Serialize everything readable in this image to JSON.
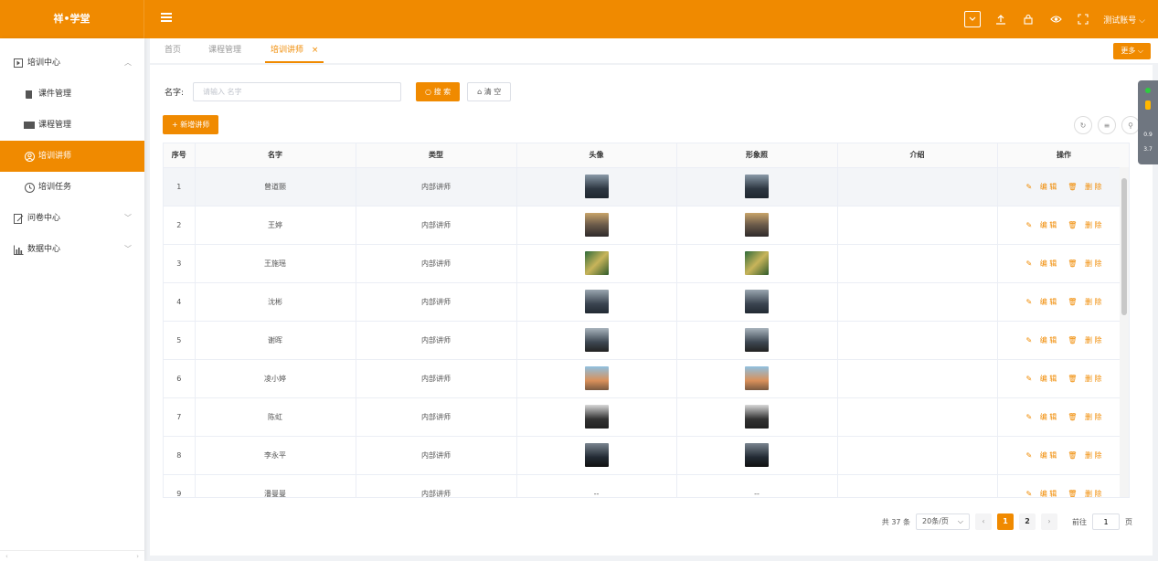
{
  "brand": "祥•学堂",
  "topbar": {
    "account": "测试账号"
  },
  "sidebar": {
    "items": [
      {
        "label": "培训中心"
      },
      {
        "label": "课件管理"
      },
      {
        "label": "课程管理"
      },
      {
        "label": "培训讲师"
      },
      {
        "label": "培训任务"
      },
      {
        "label": "问卷中心"
      },
      {
        "label": "数据中心"
      }
    ]
  },
  "tabs": [
    {
      "label": "首页"
    },
    {
      "label": "课程管理"
    },
    {
      "label": "培训讲师"
    }
  ],
  "more_label": "更多",
  "search": {
    "label": "名字:",
    "placeholder": "请输入 名字",
    "search_btn": "搜 索",
    "clear_btn": "清 空"
  },
  "add_btn": "+ 新增讲师",
  "table": {
    "headers": [
      "序号",
      "名字",
      "类型",
      "头像",
      "形象照",
      "介绍",
      "操作"
    ],
    "rows": [
      {
        "no": "1",
        "name": "曾道颢",
        "type": "内部讲师"
      },
      {
        "no": "2",
        "name": "王婷",
        "type": "内部讲师"
      },
      {
        "no": "3",
        "name": "王施瑶",
        "type": "内部讲师"
      },
      {
        "no": "4",
        "name": "沈彬",
        "type": "内部讲师"
      },
      {
        "no": "5",
        "name": "谢晖",
        "type": "内部讲师"
      },
      {
        "no": "6",
        "name": "凌小婷",
        "type": "内部讲师"
      },
      {
        "no": "7",
        "name": "陈虹",
        "type": "内部讲师"
      },
      {
        "no": "8",
        "name": "李永平",
        "type": "内部讲师"
      },
      {
        "no": "9",
        "name": "潘曼曼",
        "type": "内部讲师",
        "avatar": "--",
        "photo": "--"
      }
    ],
    "edit_label": "编 辑",
    "delete_label": "删 除"
  },
  "pager": {
    "total": "共 37 条",
    "page_size": "20条/页",
    "pages": [
      "1",
      "2"
    ],
    "goto_label": "前往",
    "goto_value": "1",
    "page_unit": "页"
  },
  "float_widget": {
    "v1": "0.9",
    "v2": "3.7"
  },
  "colors": {
    "accent": "#f08a00"
  }
}
